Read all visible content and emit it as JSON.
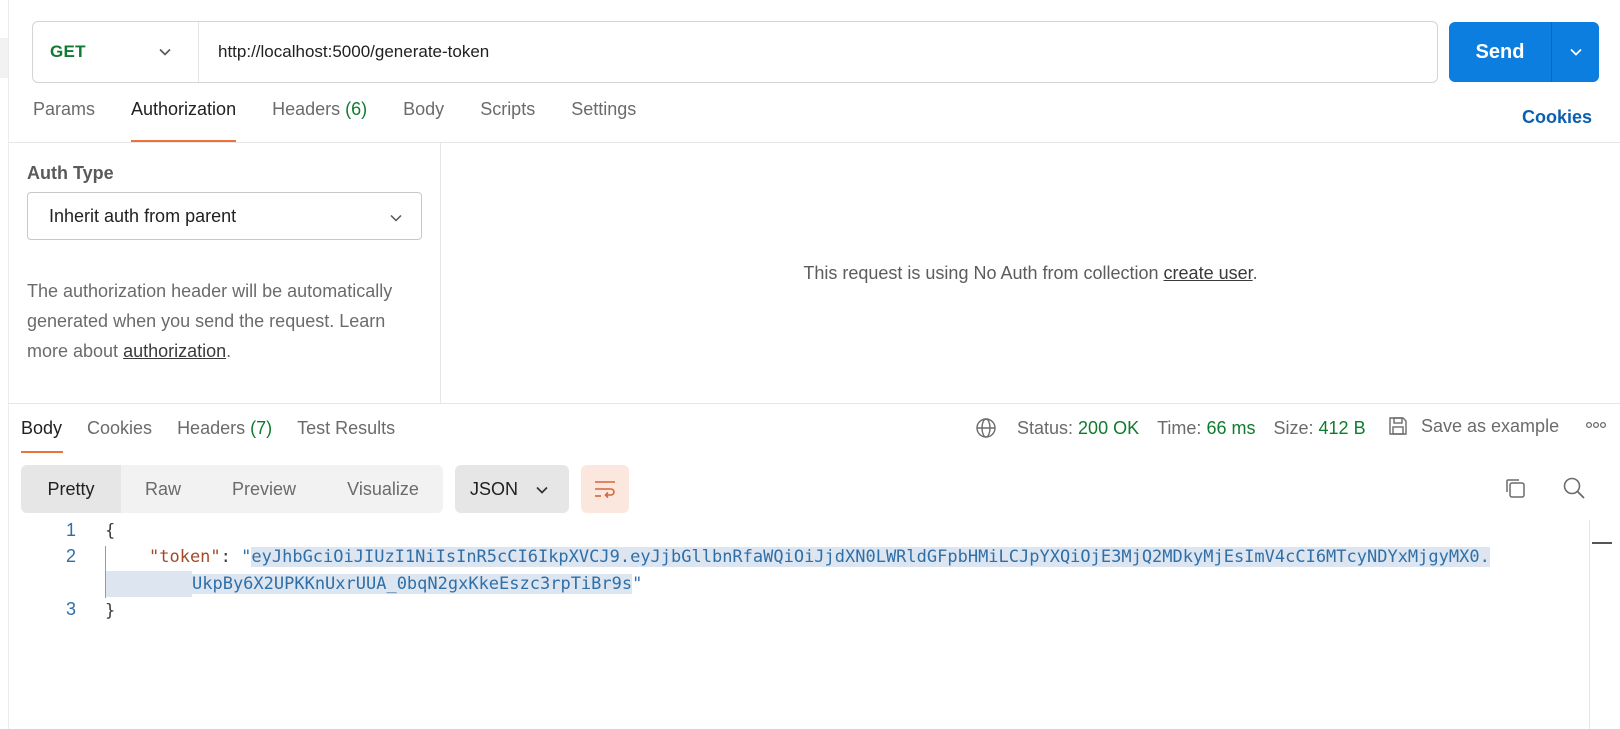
{
  "request": {
    "method": "GET",
    "url": "http://localhost:5000/generate-token",
    "send_label": "Send"
  },
  "request_tabs": [
    {
      "label": "Params"
    },
    {
      "label": "Authorization",
      "active": true
    },
    {
      "label": "Headers",
      "count": "(6)"
    },
    {
      "label": "Body"
    },
    {
      "label": "Scripts"
    },
    {
      "label": "Settings"
    }
  ],
  "cookies_link": "Cookies",
  "auth": {
    "type_label": "Auth Type",
    "type_value": "Inherit auth from parent",
    "desc_before": "The authorization header will be automatically generated when you send the request. Learn more about ",
    "desc_link": "authorization",
    "desc_after": ".",
    "info_before": "This request is using No Auth from collection ",
    "info_link": "create user",
    "info_after": "."
  },
  "response_tabs": [
    {
      "label": "Body",
      "active": true
    },
    {
      "label": "Cookies"
    },
    {
      "label": "Headers",
      "count": "(7)"
    },
    {
      "label": "Test Results"
    }
  ],
  "response_meta": {
    "status_label": "Status:",
    "status_value": "200 OK",
    "time_label": "Time:",
    "time_value": "66 ms",
    "size_label": "Size:",
    "size_value": "412 B",
    "save_label": "Save as example"
  },
  "body_modes": [
    "Pretty",
    "Raw",
    "Preview",
    "Visualize"
  ],
  "format": "JSON",
  "code": {
    "line_numbers": [
      "1",
      "2",
      "3"
    ],
    "open_brace": "{",
    "close_brace": "}",
    "key": "\"token\"",
    "colon": ": ",
    "quote": "\"",
    "token_part1": "eyJhbGciOiJIUzI1NiIsInR5cCI6IkpXVCJ9.eyJjbGllbnRfaWQiOiJjdXN0LWRldGFpbHMiLCJpYXQiOjE3MjQ2MDkyMjEsImV4cCI6MTcyNDYxMjgyMX0.",
    "token_part2": "UkpBy6X2UPKKnUxrUUA_0bqN2gxKkeEszc3rpTiBr9s"
  },
  "colors": {
    "accent": "#e8743c",
    "send": "#0b7ee0",
    "method": "#107b2f",
    "status_ok": "#107b2f"
  },
  "icons": [
    "chevron-down-icon",
    "globe-icon",
    "save-icon",
    "more-icon",
    "wrap-icon",
    "copy-icon",
    "search-icon"
  ]
}
